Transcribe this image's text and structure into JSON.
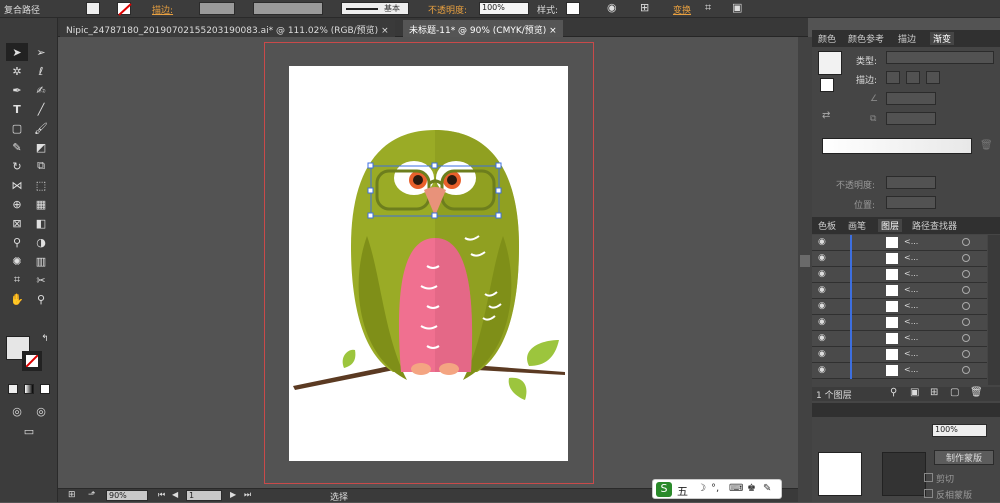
{
  "control_bar": {
    "selection_type": "复合路径",
    "stroke_label": "描边:",
    "stroke_style": "基本",
    "opacity_label": "不透明度:",
    "opacity_value": "100%",
    "style_label": "样式:",
    "transform_label": "变换"
  },
  "tabs": [
    {
      "label": "Nipic_24787180_20190702155203190083.ai* @ 111.02% (RGB/预览)"
    },
    {
      "label": "未标题-11* @ 90% (CMYK/预览)"
    }
  ],
  "gradient_panel": {
    "tabs": [
      "颜色",
      "颜色参考",
      "描边",
      "渐变"
    ],
    "type_label": "类型:",
    "stroke_label": "描边:",
    "opacity_label": "不透明度:",
    "position_label": "位置:"
  },
  "layers_panel": {
    "tabs": [
      "色板",
      "画笔",
      "图层",
      "路径查找器"
    ],
    "row_label": "<...",
    "layer_count": "1 个图层",
    "row_count": 9
  },
  "transparency": {
    "make_mask": "制作蒙版",
    "clip": "剪切",
    "invert_mask": "反相蒙版",
    "opacity_value": "100%"
  },
  "status_bar": {
    "zoom": "90%",
    "page": "1",
    "tool": "选择"
  },
  "ime": {
    "label": "五"
  },
  "colors": {
    "owl_body": "#9aab26",
    "owl_body_dark": "#8a9a1e",
    "owl_belly": "#f07090",
    "branch": "#5b3a22",
    "leaf": "#9cc53d",
    "beak": "#e8927a",
    "selection": "#3d6fe0"
  }
}
